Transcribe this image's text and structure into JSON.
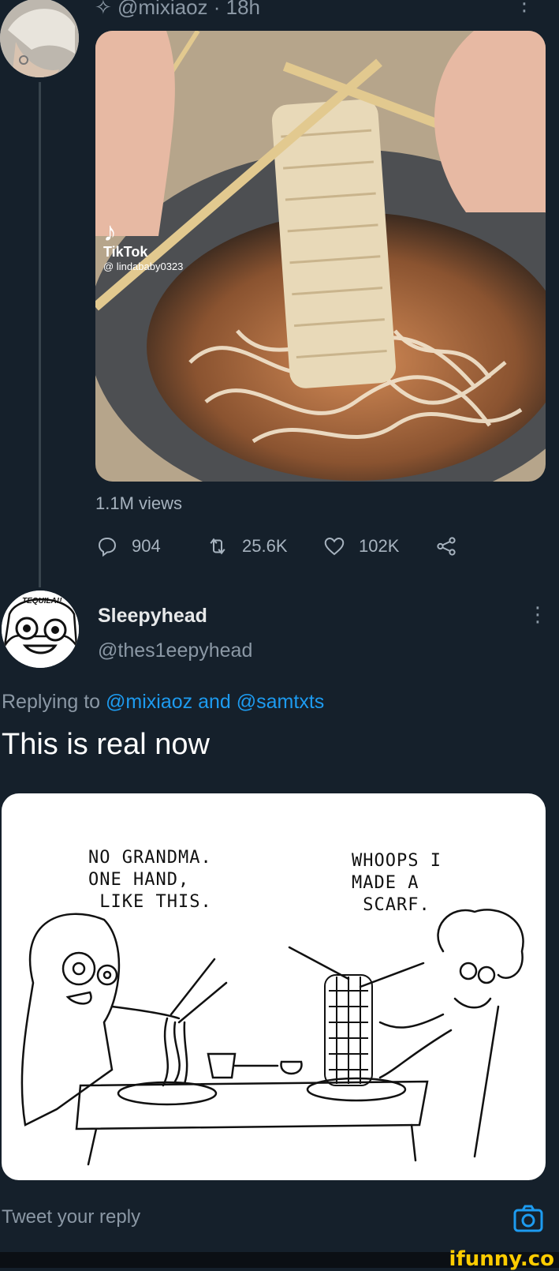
{
  "tweet1": {
    "handle": "@mixiaoz",
    "time": "18h",
    "header_line": "✧ @mixiaoz · 18h",
    "media": {
      "watermark_name": "TikTok",
      "watermark_user": "@ lindababy0323"
    },
    "views": "1.1M views",
    "actions": {
      "replies": "904",
      "retweets": "25.6K",
      "likes": "102K"
    }
  },
  "tweet2": {
    "avatar_text": "TEQUILA!!",
    "display_name": "Sleepyhead",
    "handle": "@thes1eepyhead",
    "replying_prefix": "Replying to ",
    "replying_user1": "@mixiaoz",
    "replying_and": " and ",
    "replying_user2": "@samtxts",
    "text": "This is real now",
    "comic": {
      "left_speech": "NO GRANDMA.\nONE HAND,\n LIKE THIS.",
      "right_speech": "WHOOPS I\nMADE A\n SCARF."
    }
  },
  "composer": {
    "placeholder": "Tweet your reply"
  },
  "watermark": "ifunny.co",
  "colors": {
    "background": "#15202b",
    "accent": "#1d9bf0",
    "secondary_text": "#8b98a5",
    "watermark": "#ffcc00"
  },
  "icons": [
    "sparkle-icon",
    "more-icon",
    "reply-icon",
    "retweet-icon",
    "like-icon",
    "share-icon",
    "camera-icon"
  ]
}
